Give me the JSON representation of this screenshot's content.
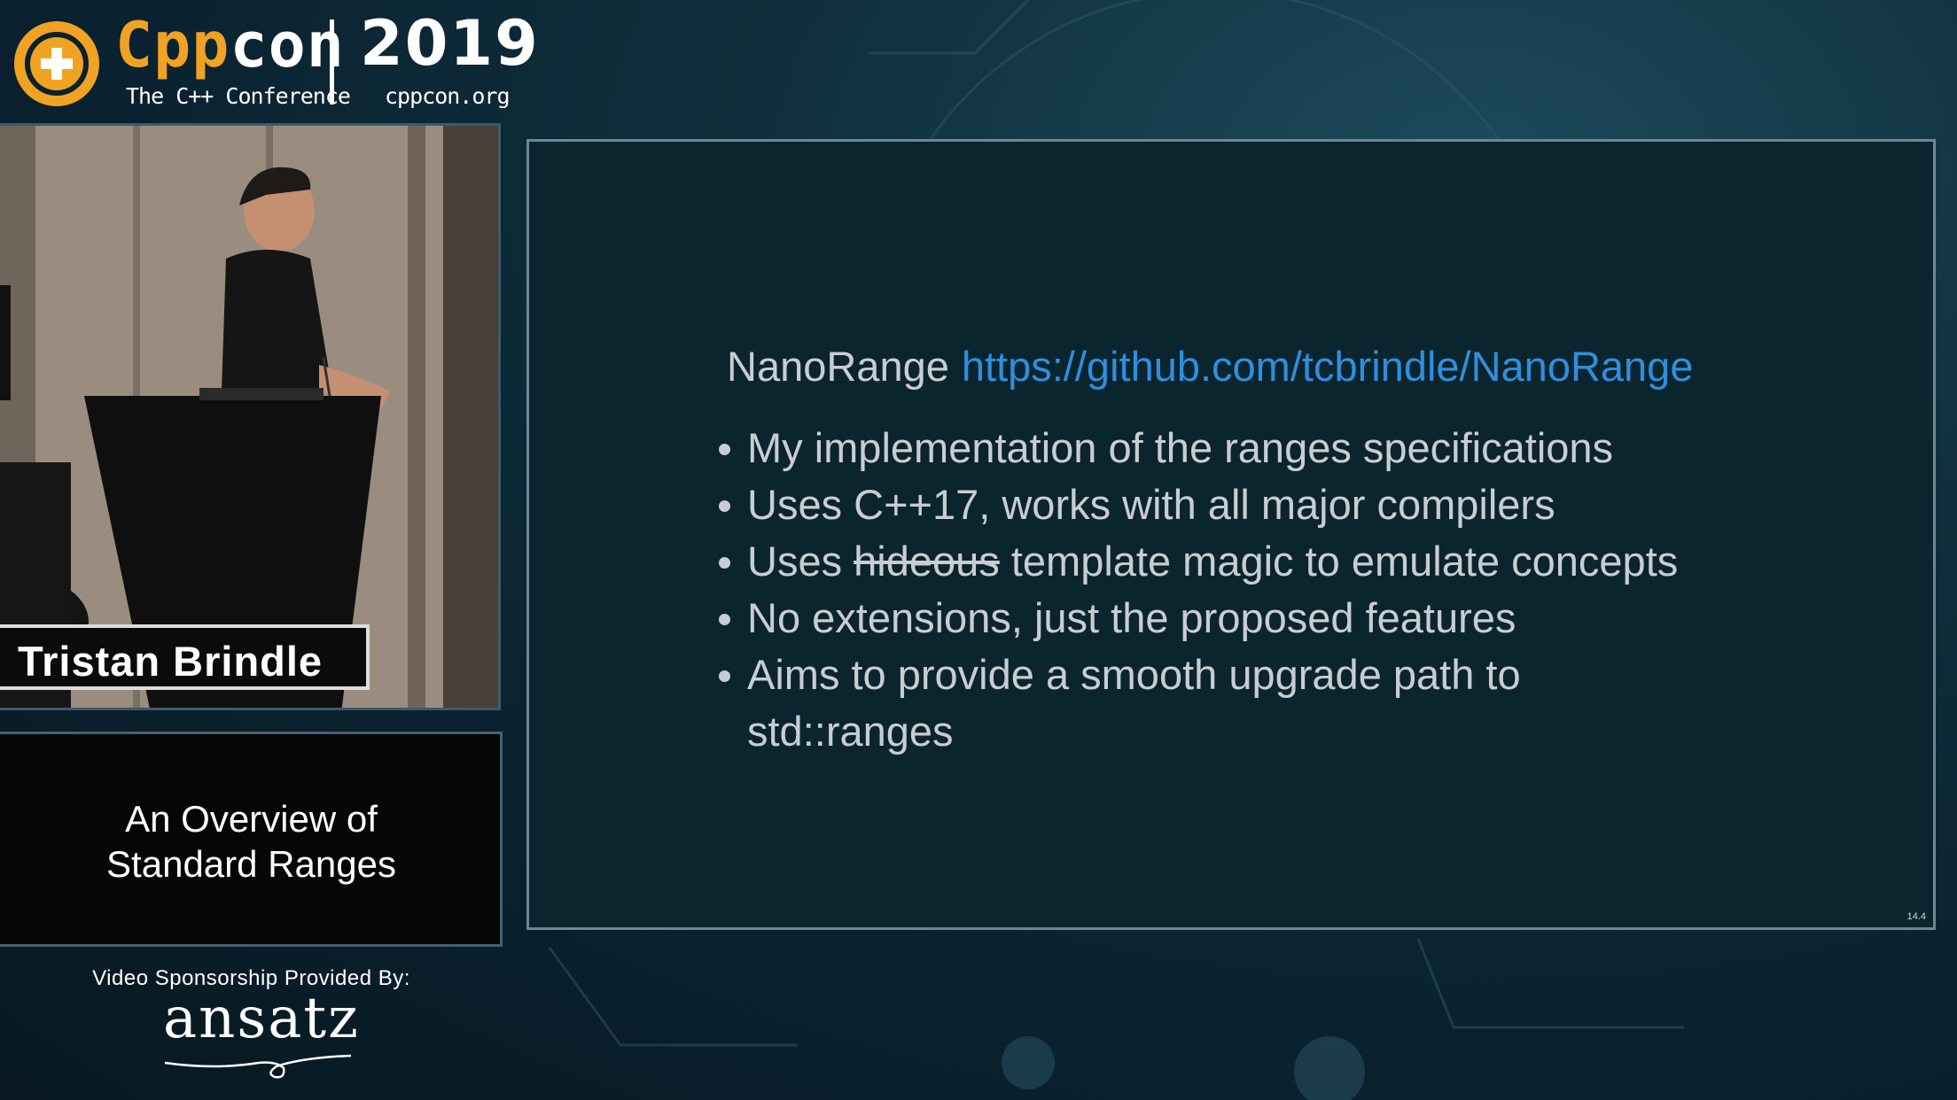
{
  "header": {
    "brand_cpp": "Cpp",
    "brand_con": "con",
    "tagline": "The C++ Conference",
    "year": "2019",
    "site": "cppcon.org",
    "accent_color": "#f0a323"
  },
  "speaker": {
    "name": "Tristan Brindle"
  },
  "talk": {
    "title_line1": "An Overview of",
    "title_line2": "Standard Ranges"
  },
  "sponsor": {
    "label": "Video Sponsorship Provided By:",
    "name": "ansatz"
  },
  "slide": {
    "heading": "NanoRange",
    "link": "https://github.com/tcbrindle/NanoRange",
    "link_color": "#2f8fdc",
    "bullets": [
      "My implementation of the ranges specifications",
      "Uses C++17, works with all major compilers",
      "No extensions, just the proposed features",
      "Aims to provide a smooth upgrade path to"
    ],
    "bullet3": {
      "pre": "Uses",
      "struck": "hideous",
      "post": "template magic to emulate concepts"
    },
    "bullet5_cont": "std::ranges",
    "page_number": "14.4"
  }
}
